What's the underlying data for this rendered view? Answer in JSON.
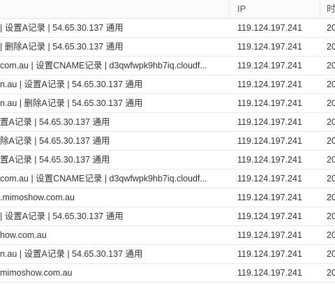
{
  "table": {
    "columns": {
      "ip": "IP",
      "time": "时"
    },
    "rows": [
      {
        "desc": "| 设置A记录 | 54.65.30.137 通用",
        "ip": "119.124.197.241",
        "time": "20"
      },
      {
        "desc": "| 删除A记录 | 54.65.30.137 通用",
        "ip": "119.124.197.241",
        "time": "20"
      },
      {
        "desc": "com.au | 设置CNAME记录 | d3qwfwpk9hb7iq.cloudf...",
        "ip": "119.124.197.241",
        "time": "20"
      },
      {
        "desc": "n.au | 设置A记录 | 54.65.30.137 通用",
        "ip": "119.124.197.241",
        "time": "20"
      },
      {
        "desc": "n.au | 删除A记录 | 54.65.30.137 通用",
        "ip": "119.124.197.241",
        "time": "20"
      },
      {
        "desc": "置A记录 | 54.65.30.137 通用",
        "ip": "119.124.197.241",
        "time": "20"
      },
      {
        "desc": "除A记录 | 54.65.30.137 通用",
        "ip": "119.124.197.241",
        "time": "20"
      },
      {
        "desc": "置A记录 | 54.65.30.137 通用",
        "ip": "119.124.197.241",
        "time": "20"
      },
      {
        "desc": "com.au | 设置CNAME记录 | d3qwfwpk9hb7iq.cloudf...",
        "ip": "119.124.197.241",
        "time": "20"
      },
      {
        "desc": ".mimoshow.com.au",
        "ip": "119.124.197.241",
        "time": "20"
      },
      {
        "desc": "| 设置A记录 | 54.65.30.137 通用",
        "ip": "119.124.197.241",
        "time": "20"
      },
      {
        "desc": "how.com.au",
        "ip": "119.124.197.241",
        "time": "20"
      },
      {
        "desc": "n.au | 设置A记录 | 54.65.30.137 通用",
        "ip": "119.124.197.241",
        "time": "20"
      },
      {
        "desc": "mimoshow.com.au",
        "ip": "119.124.197.241",
        "time": "20"
      }
    ]
  }
}
